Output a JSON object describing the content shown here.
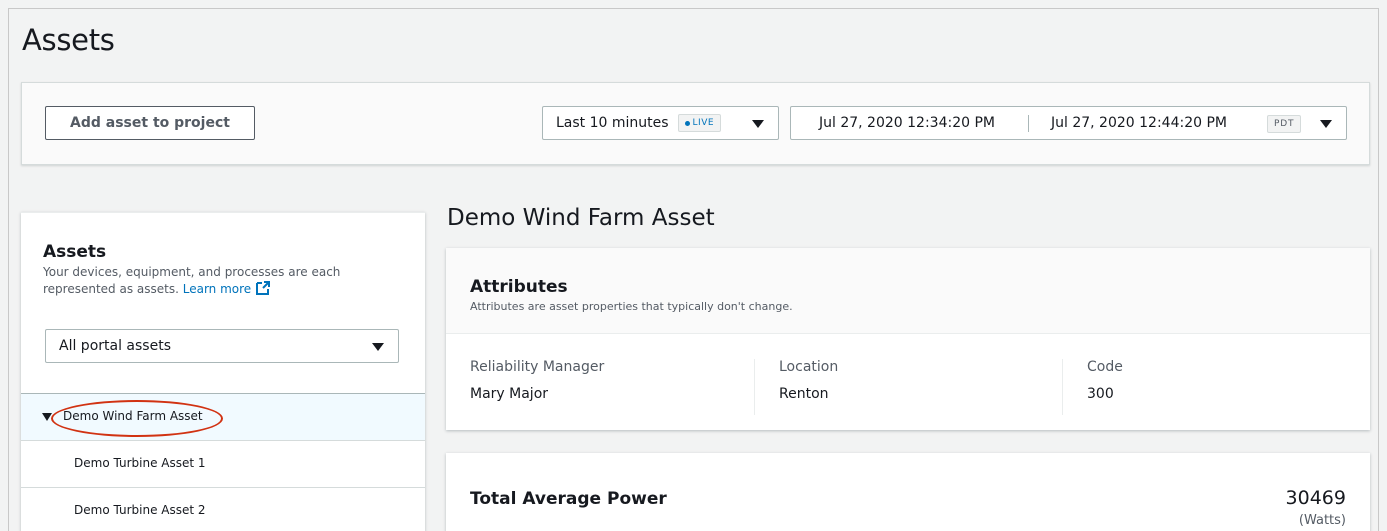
{
  "page": {
    "title": "Assets"
  },
  "toolbar": {
    "add_asset_label": "Add asset to project",
    "time_range": "Last 10 minutes",
    "live_label": "LIVE",
    "date_start": "Jul 27, 2020 12:34:20 PM",
    "date_end": "Jul 27, 2020 12:44:20 PM",
    "timezone": "PDT"
  },
  "sidebar": {
    "title": "Assets",
    "description": "Your devices, equipment, and processes are each represented as assets.",
    "learn_more": "Learn more",
    "filter_value": "All portal assets",
    "tree": [
      {
        "label": "Demo Wind Farm Asset",
        "selected": true,
        "expanded": true
      },
      {
        "label": "Demo Turbine Asset 1",
        "selected": false
      },
      {
        "label": "Demo Turbine Asset 2",
        "selected": false
      }
    ]
  },
  "asset": {
    "title": "Demo Wind Farm Asset",
    "attributes": {
      "title": "Attributes",
      "description": "Attributes are asset properties that typically don't change.",
      "items": [
        {
          "key": "Reliability Manager",
          "value": "Mary Major"
        },
        {
          "key": "Location",
          "value": "Renton"
        },
        {
          "key": "Code",
          "value": "300"
        }
      ]
    },
    "metric": {
      "title": "Total Average Power",
      "value": "30469",
      "unit": "(Watts)"
    }
  },
  "colors": {
    "accent": "#0073bb",
    "highlight": "#d13212",
    "selected_row": "#f1faff"
  },
  "icons": [
    "external-link-icon",
    "caret-down-icon",
    "live-dot-icon",
    "tree-expand-icon"
  ]
}
